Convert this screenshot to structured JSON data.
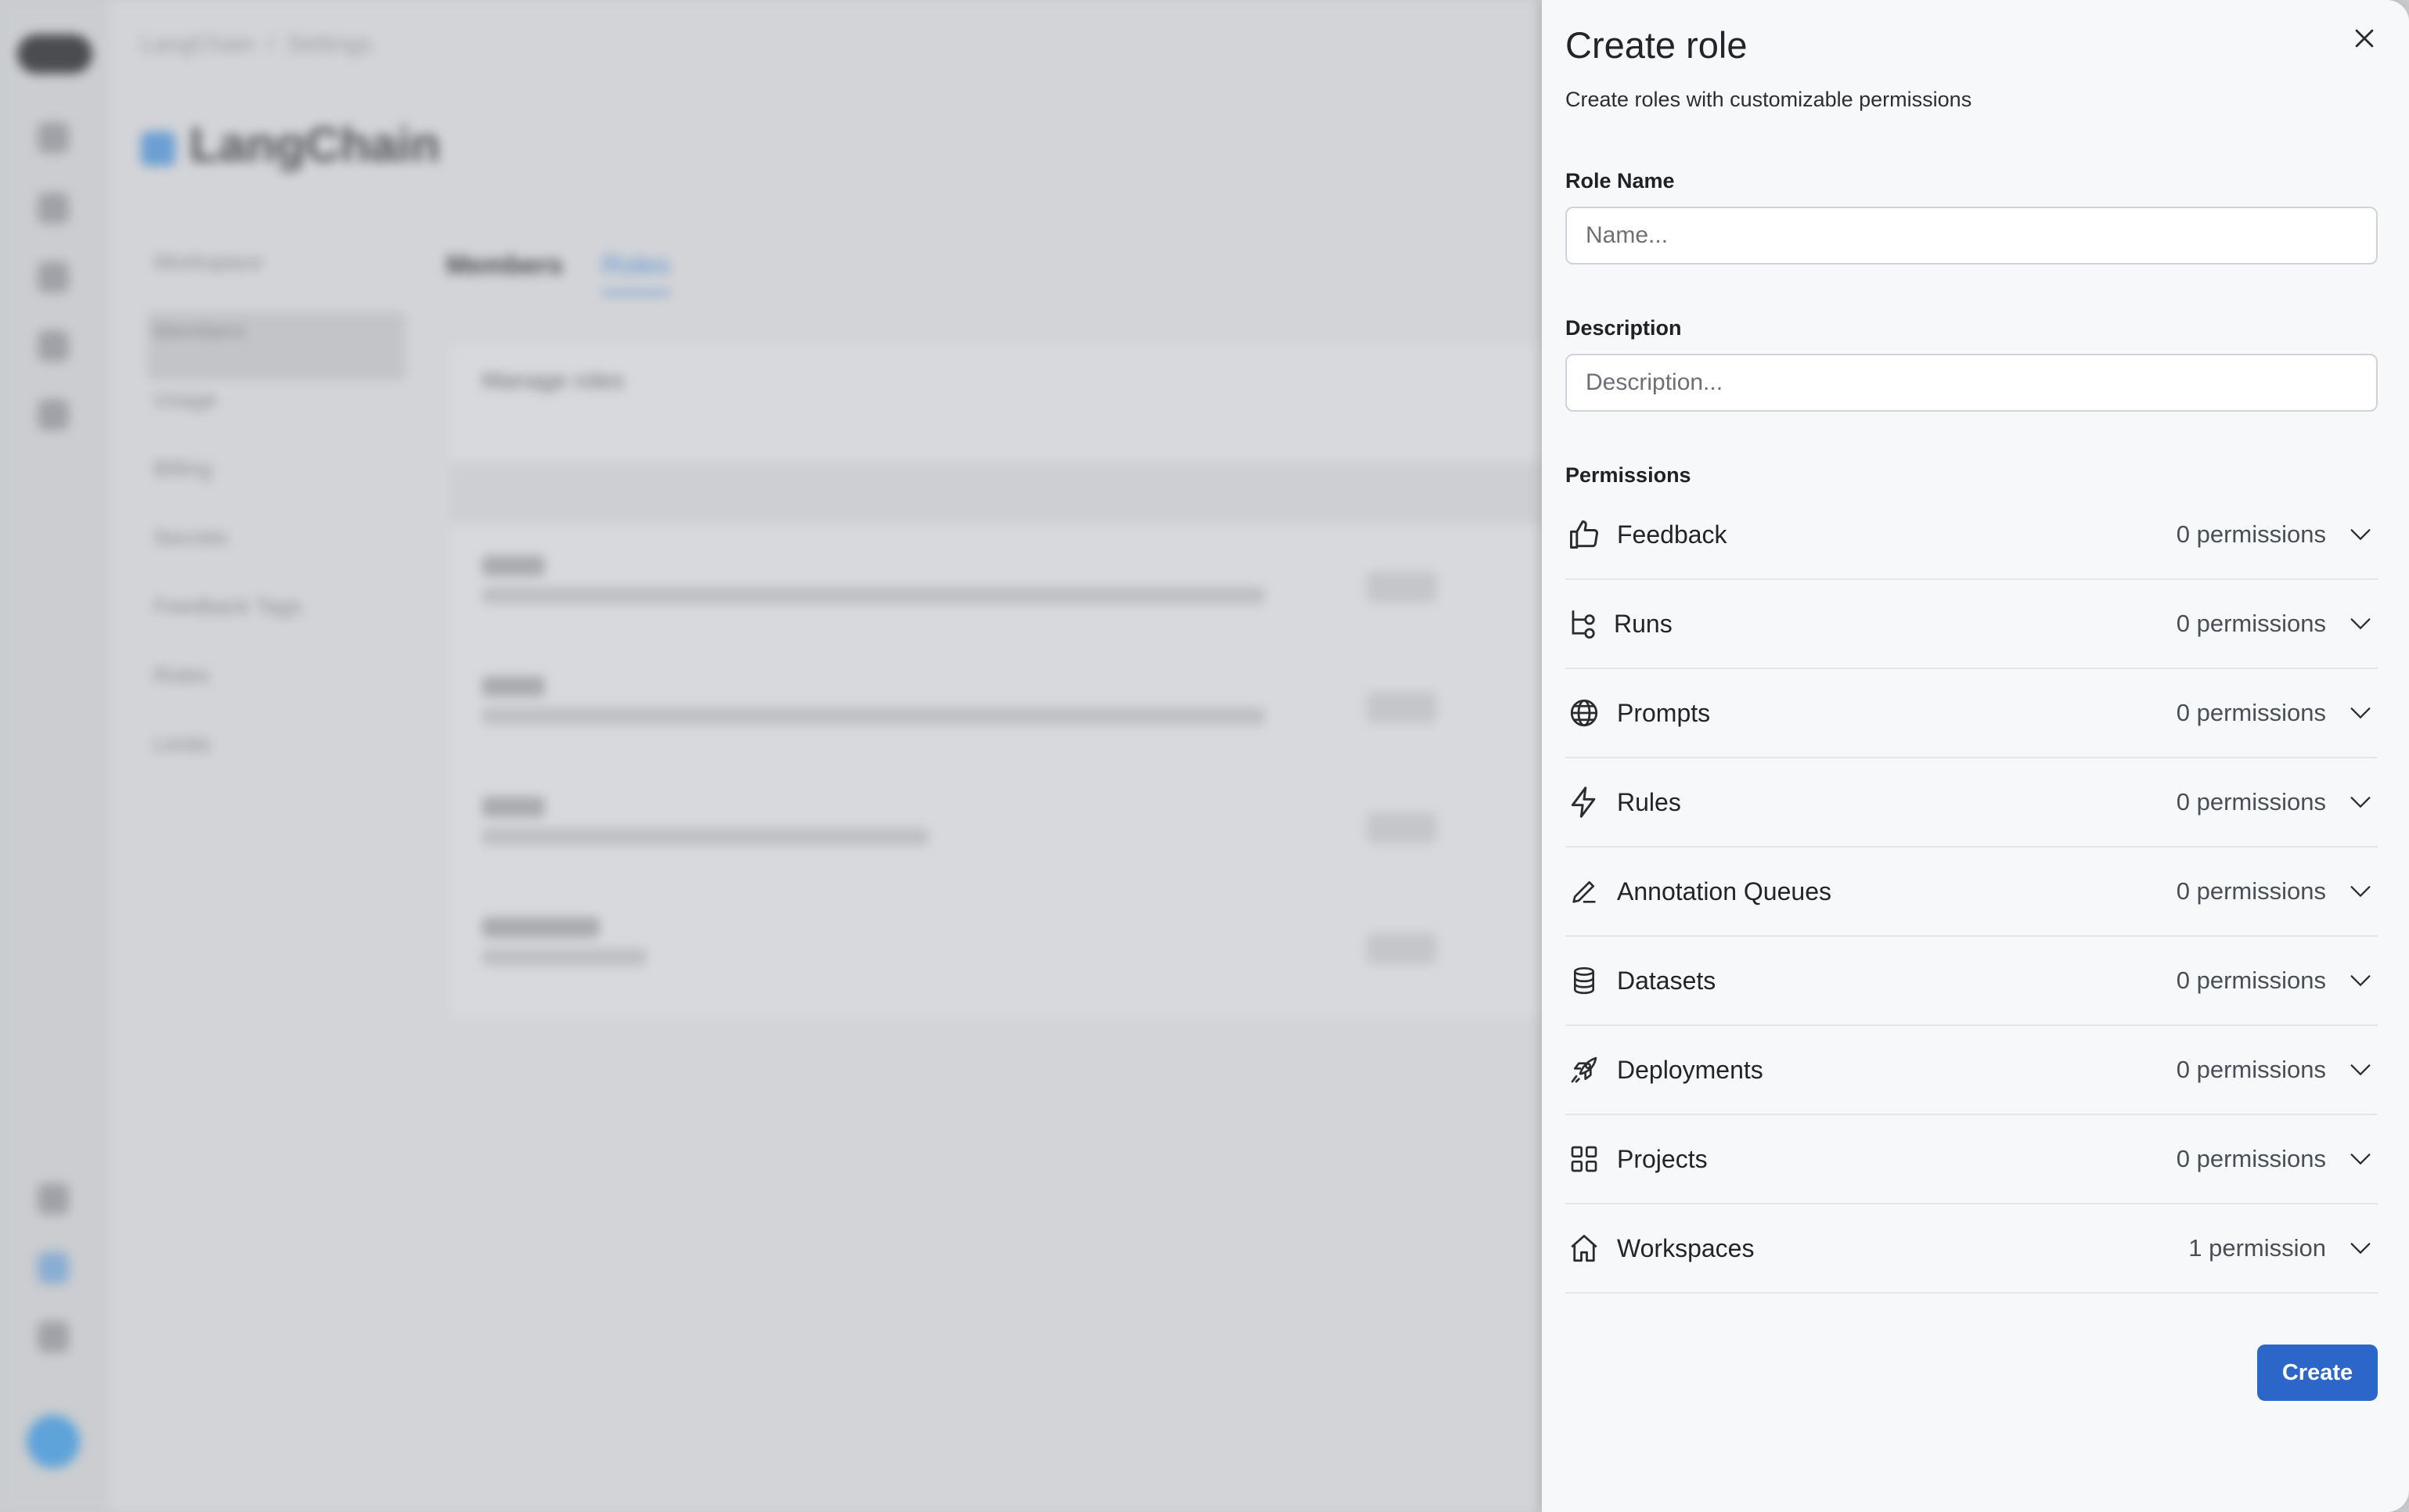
{
  "background": {
    "breadcrumb": [
      "LangChain",
      "Settings"
    ],
    "org_title": "LangChain",
    "nav_items": [
      "Workspace",
      "Members",
      "Usage",
      "Billing",
      "Secrets",
      "Feedback Tags",
      "Roles",
      "Limits"
    ],
    "tabs": [
      "Members",
      "Roles"
    ],
    "card_header": "Manage roles"
  },
  "dialog": {
    "title": "Create role",
    "subtitle": "Create roles with customizable permissions",
    "role_name_label": "Role Name",
    "role_name_placeholder": "Name...",
    "role_name_value": "",
    "description_label": "Description",
    "description_placeholder": "Description...",
    "description_value": "",
    "permissions_label": "Permissions",
    "create_label": "Create",
    "permissions": [
      {
        "name": "Feedback",
        "count": "0 permissions",
        "icon": "thumbs-up-icon"
      },
      {
        "name": "Runs",
        "count": "0 permissions",
        "icon": "runs-branch-icon"
      },
      {
        "name": "Prompts",
        "count": "0 permissions",
        "icon": "globe-icon"
      },
      {
        "name": "Rules",
        "count": "0 permissions",
        "icon": "lightning-icon"
      },
      {
        "name": "Annotation Queues",
        "count": "0 permissions",
        "icon": "pencil-icon"
      },
      {
        "name": "Datasets",
        "count": "0 permissions",
        "icon": "database-icon"
      },
      {
        "name": "Deployments",
        "count": "0 permissions",
        "icon": "rocket-icon"
      },
      {
        "name": "Projects",
        "count": "0 permissions",
        "icon": "grid-icon"
      },
      {
        "name": "Workspaces",
        "count": "1 permission",
        "icon": "home-icon"
      }
    ]
  }
}
